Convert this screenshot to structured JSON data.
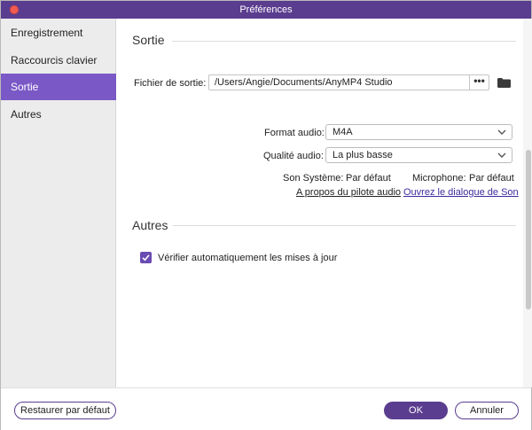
{
  "window": {
    "title": "Préférences"
  },
  "sidebar": {
    "items": [
      {
        "label": "Enregistrement"
      },
      {
        "label": "Raccourcis clavier"
      },
      {
        "label": "Sortie"
      },
      {
        "label": "Autres"
      }
    ],
    "active_index": 2
  },
  "sortie": {
    "title": "Sortie",
    "output_file_label": "Fichier de sortie:",
    "output_file_value": "/Users/Angie/Documents/AnyMP4 Studio",
    "browse_label": "•••",
    "audio_format_label": "Format audio:",
    "audio_format_value": "M4A",
    "audio_quality_label": "Qualité audio:",
    "audio_quality_value": "La plus basse",
    "system_sound_label": "Son Système:",
    "system_sound_value": "Par défaut",
    "microphone_label": "Microphone:",
    "microphone_value": "Par défaut",
    "driver_link": "A propos du pilote audio",
    "sound_dialog_link": "Ouvrez le dialogue de Son"
  },
  "autres": {
    "title": "Autres",
    "auto_update_label": "Vérifier automatiquement les mises à jour",
    "auto_update_checked": true
  },
  "footer": {
    "restore_label": "Restaurer par défaut",
    "ok_label": "OK",
    "cancel_label": "Annuler"
  },
  "colors": {
    "accent": "#5b3d8f",
    "sidebar_active": "#7a58c6",
    "link": "#3b2b9e"
  }
}
